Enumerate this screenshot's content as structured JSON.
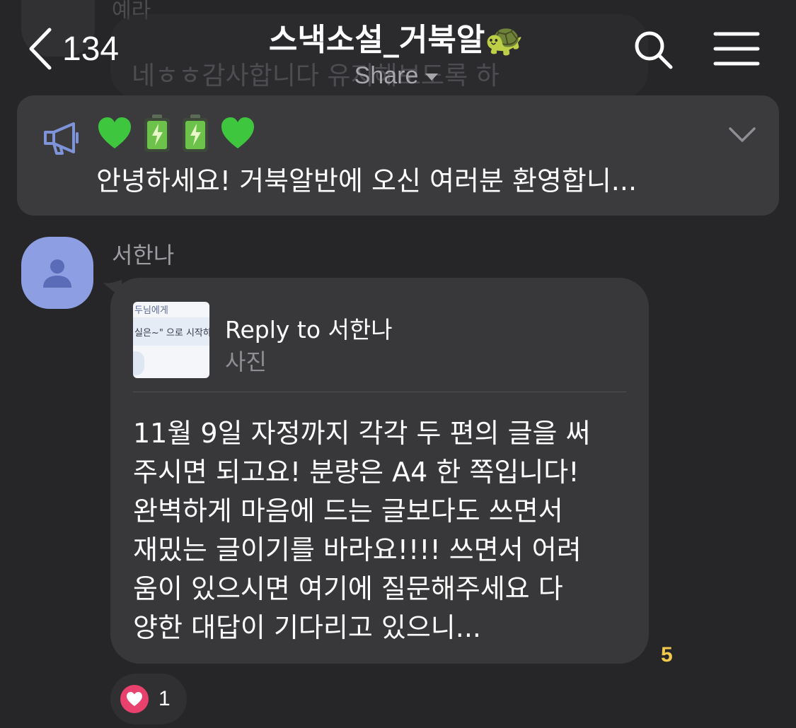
{
  "background_message": {
    "sender": "예라",
    "text": "네ㅎㅎ감사합니다 유지해보도록 하"
  },
  "header": {
    "back_count": "134",
    "title": "스낵소설_거북알🐢",
    "share_label": "Share",
    "icons": [
      "chevron-left-icon",
      "search-icon",
      "menu-icon"
    ]
  },
  "notice": {
    "icon": "megaphone-icon",
    "emoji": [
      "green-heart",
      "battery",
      "battery",
      "green-heart"
    ],
    "text": "안녕하세요! 거북알반에 오신 여러분 환영합니...",
    "expand_icon": "chevron-down-icon"
  },
  "message": {
    "sender": "서한나",
    "reply": {
      "title": "Reply to 서한나",
      "subtitle": "사진",
      "thumbnail_text_1": "두님에게",
      "thumbnail_text_2": "실은~\" 으로 시작하"
    },
    "text": "11월 9일 자정까지 각각 두 편의 글을 써\n주시면 되고요! 분량은 A4 한 쪽입니다!\n완벽하게 마음에 드는 글보다도 쓰면서\n재밌는 글이기를 바라요!!!! 쓰면서 어려\n움이 있으시면 여기에 질문해주세요 다\n양한 대답이 기다리고 있으니...",
    "unread_count": "5",
    "reaction": {
      "icon": "heart-icon",
      "count": "1"
    }
  },
  "colors": {
    "background": "#262628",
    "bubble": "#38383b",
    "notice_bg": "#3b3b3e",
    "avatar": "#8e9ee2",
    "unread": "#f2c94c",
    "heart": "#e8416e",
    "megaphone": "#7f93d8"
  }
}
